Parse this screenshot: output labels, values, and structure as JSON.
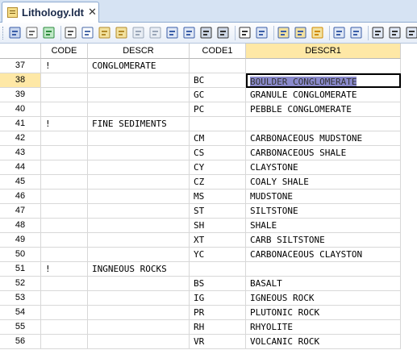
{
  "tab": {
    "label": "Lithology.ldt",
    "close": "✕"
  },
  "toolbar": {
    "buttons": [
      {
        "name": "save-icon",
        "c1": "#3b5ea8",
        "c2": "#c9d6ee"
      },
      {
        "name": "print-preview-icon",
        "c1": "#6b6b6b",
        "c2": "#ffffff"
      },
      {
        "name": "refresh-icon",
        "c1": "#2e8b3d",
        "c2": "#bfe8c6"
      },
      {
        "sep": true
      },
      {
        "name": "cut-icon",
        "c1": "#555555",
        "c2": "#ffffff"
      },
      {
        "name": "copy-icon",
        "c1": "#4a6aa8",
        "c2": "#ffffff"
      },
      {
        "name": "paste-icon",
        "c1": "#b38b2a",
        "c2": "#f3e2a0"
      },
      {
        "name": "paste-special-icon",
        "c1": "#b38b2a",
        "c2": "#f3e2a0"
      },
      {
        "name": "undo-icon",
        "c1": "#9aa6b8",
        "c2": "#e8edf4"
      },
      {
        "name": "redo-icon",
        "c1": "#9aa6b8",
        "c2": "#e8edf4"
      },
      {
        "name": "insert-row-icon",
        "c1": "#3b5ea8",
        "c2": "#dfe7f5"
      },
      {
        "name": "append-row-icon",
        "c1": "#3b5ea8",
        "c2": "#dfe7f5"
      },
      {
        "name": "find-icon",
        "c1": "#333333",
        "c2": "#cfd8e6"
      },
      {
        "name": "replace-icon",
        "c1": "#333333",
        "c2": "#cfd8e6"
      },
      {
        "sep": true
      },
      {
        "name": "filter-icon",
        "c1": "#333333",
        "c2": "#ffffff"
      },
      {
        "name": "columns-icon",
        "c1": "#3b5ea8",
        "c2": "#dfe7f5"
      },
      {
        "sep": true
      },
      {
        "name": "edit-record-icon",
        "c1": "#3b5ea8",
        "c2": "#f3e2a0"
      },
      {
        "name": "edit-field-icon",
        "c1": "#3b5ea8",
        "c2": "#f3e2a0"
      },
      {
        "name": "add-record-icon",
        "c1": "#d08a00",
        "c2": "#f3e2a0"
      },
      {
        "sep": true
      },
      {
        "name": "move-down-icon",
        "c1": "#3b5ea8",
        "c2": "#dfe7f5"
      },
      {
        "name": "move-bottom-icon",
        "c1": "#3b5ea8",
        "c2": "#dfe7f5"
      },
      {
        "sep": true
      },
      {
        "name": "sort-ascending-icon",
        "c1": "#333333",
        "c2": "#dfe7f5"
      },
      {
        "name": "sort-descending-icon",
        "c1": "#333333",
        "c2": "#dfe7f5"
      },
      {
        "name": "sort-options-icon",
        "c1": "#333333",
        "c2": "#dfe7f5"
      }
    ]
  },
  "columns": [
    "",
    "CODE",
    "DESCR",
    "CODE1",
    "DESCR1"
  ],
  "selected_column": "DESCR1",
  "selected_row": "38",
  "rows": [
    {
      "n": "37",
      "code": "!",
      "descr": "CONGLOMERATE",
      "code1": "",
      "descr1": ""
    },
    {
      "n": "38",
      "code": "",
      "descr": "",
      "code1": "BC",
      "descr1": "BOULDER CONGLOMERATE"
    },
    {
      "n": "39",
      "code": "",
      "descr": "",
      "code1": "GC",
      "descr1": "GRANULE CONGLOMERATE"
    },
    {
      "n": "40",
      "code": "",
      "descr": "",
      "code1": "PC",
      "descr1": "PEBBLE CONGLOMERATE"
    },
    {
      "n": "41",
      "code": "!",
      "descr": "FINE SEDIMENTS",
      "code1": "",
      "descr1": ""
    },
    {
      "n": "42",
      "code": "",
      "descr": "",
      "code1": "CM",
      "descr1": "CARBONACEOUS MUDSTONE"
    },
    {
      "n": "43",
      "code": "",
      "descr": "",
      "code1": "CS",
      "descr1": "CARBONACEOUS SHALE"
    },
    {
      "n": "44",
      "code": "",
      "descr": "",
      "code1": "CY",
      "descr1": "CLAYSTONE"
    },
    {
      "n": "45",
      "code": "",
      "descr": "",
      "code1": "CZ",
      "descr1": "COALY SHALE"
    },
    {
      "n": "46",
      "code": "",
      "descr": "",
      "code1": "MS",
      "descr1": "MUDSTONE"
    },
    {
      "n": "47",
      "code": "",
      "descr": "",
      "code1": "ST",
      "descr1": "SILTSTONE"
    },
    {
      "n": "48",
      "code": "",
      "descr": "",
      "code1": "SH",
      "descr1": "SHALE"
    },
    {
      "n": "49",
      "code": "",
      "descr": "",
      "code1": "XT",
      "descr1": "CARB SILTSTONE"
    },
    {
      "n": "50",
      "code": "",
      "descr": "",
      "code1": "YC",
      "descr1": "CARBONACEOUS CLAYSTON"
    },
    {
      "n": "51",
      "code": "!",
      "descr": "INGNEOUS ROCKS",
      "code1": "",
      "descr1": ""
    },
    {
      "n": "52",
      "code": "",
      "descr": "",
      "code1": "BS",
      "descr1": "BASALT"
    },
    {
      "n": "53",
      "code": "",
      "descr": "",
      "code1": "IG",
      "descr1": "IGNEOUS ROCK"
    },
    {
      "n": "54",
      "code": "",
      "descr": "",
      "code1": "PR",
      "descr1": "PLUTONIC ROCK"
    },
    {
      "n": "55",
      "code": "",
      "descr": "",
      "code1": "RH",
      "descr1": "RHYOLITE"
    },
    {
      "n": "56",
      "code": "",
      "descr": "",
      "code1": "VR",
      "descr1": "VOLCANIC ROCK"
    }
  ],
  "colors": {
    "selection_header": "#fee8a6",
    "cell_highlight": "#8a8acb",
    "tab_strip": "#d6e3f3"
  }
}
